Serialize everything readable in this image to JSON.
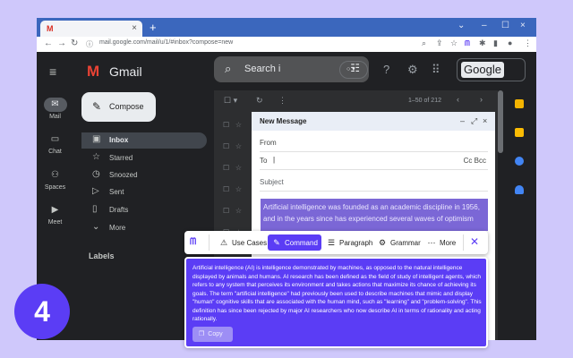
{
  "browser": {
    "tab_favicon": "M",
    "tab_close": "×",
    "new_tab": "+",
    "window_controls": [
      "⌄",
      "–",
      "☐",
      "×"
    ],
    "url": "mail.google.com/mail/u/1/#inbox?compose=new",
    "nav_icons": [
      "←",
      "→",
      "↻",
      "ⓘ"
    ],
    "ext_logo": "ᗰ"
  },
  "rail": {
    "menu": "≡",
    "items": [
      {
        "icon": "✉",
        "label": "Mail"
      },
      {
        "icon": "▭",
        "label": "Chat"
      },
      {
        "icon": "⚇",
        "label": "Spaces"
      },
      {
        "icon": "▶",
        "label": "Meet"
      }
    ]
  },
  "header": {
    "logo_text": "Gmail",
    "search_placeholder": "Search i",
    "status_icon": "○ ▾",
    "google_label": "Google"
  },
  "sidebar": {
    "compose_label": "Compose",
    "items": [
      {
        "icon": "▣",
        "label": "Inbox"
      },
      {
        "icon": "☆",
        "label": "Starred"
      },
      {
        "icon": "◷",
        "label": "Snoozed"
      },
      {
        "icon": "▷",
        "label": "Sent"
      },
      {
        "icon": "▯",
        "label": "Drafts"
      },
      {
        "icon": "⌄",
        "label": "More"
      }
    ],
    "labels_heading": "Labels"
  },
  "list": {
    "count": "1–50 of 212",
    "prev": "‹",
    "next": "›"
  },
  "message": {
    "title": "New Message",
    "controls": [
      "–",
      "⤢",
      "×"
    ],
    "from_label": "From",
    "to_label": "To",
    "cc_bcc": "Cc Bcc",
    "subject_placeholder": "Subject",
    "selected_text": "Artificial intelligence was founded as an academic discipline in 1956, and in the years since has experienced several waves of optimism"
  },
  "toolbar": {
    "buttons": [
      {
        "icon": "⚠",
        "label": "Use Cases"
      },
      {
        "icon": "✎",
        "label": "Command"
      },
      {
        "icon": "☰",
        "label": "Paragraph"
      },
      {
        "icon": "⚙",
        "label": "Grammar"
      },
      {
        "icon": "⋯",
        "label": "More"
      }
    ],
    "close": "✕"
  },
  "result": {
    "text": "Artificial intelligence (AI) is intelligence demonstrated by machines, as opposed to the natural intelligence displayed by animals and humans. AI research has been defined as the field of study of intelligent agents, which refers to any system that perceives its environment and takes actions that maximize its chance of achieving its goals. The term \"artificial intelligence\" had previously been used to describe machines that mimic and display \"human\" cognitive skills that are associated with the human mind, such as \"learning\" and \"problem-solving\". This definition has since been rejected by major AI researchers who now describe AI in terms of rationality and acting rationally.",
    "copy_label": "Copy"
  },
  "badge": "4",
  "colors": {
    "accent": "#5b3df5",
    "background": "#cfc8fb",
    "gmail_dark": "#202124"
  }
}
